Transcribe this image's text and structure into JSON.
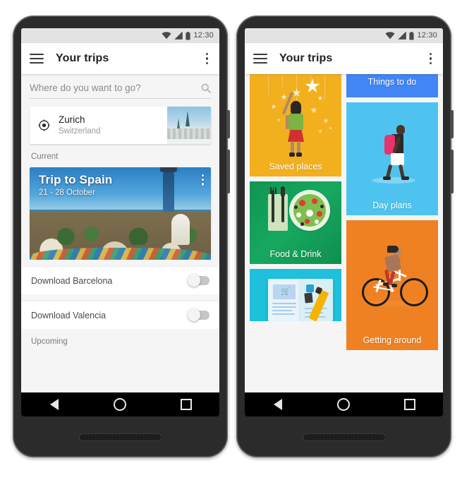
{
  "statusbar": {
    "time": "12:30",
    "wifi_icon": "wifi-icon",
    "signal_icon": "signal-icon",
    "battery_icon": "battery-icon"
  },
  "toolbar": {
    "menu_icon": "hamburger-menu-icon",
    "title": "Your trips",
    "overflow_icon": "overflow-menu-icon"
  },
  "left_screen": {
    "search": {
      "placeholder": "Where do you want to go?",
      "value": "",
      "icon": "search-icon"
    },
    "location_card": {
      "icon": "my-location-icon",
      "name": "Zurich",
      "country": "Switzerland",
      "thumb": "zurich-skyline-thumbnail"
    },
    "section_current": "Current",
    "trip": {
      "title": "Trip to Spain",
      "dates": "21 - 28 October",
      "hero": "park-guell-barcelona-photo",
      "overflow_icon": "trip-overflow-icon"
    },
    "downloads": [
      {
        "label": "Download Barcelona",
        "state": "off"
      },
      {
        "label": "Download Valencia",
        "state": "off"
      }
    ],
    "section_upcoming": "Upcoming"
  },
  "right_screen": {
    "tiles": [
      {
        "label": "Things to do",
        "color": "#4285f4",
        "illustration": "things-to-do-illustration",
        "column": "right",
        "cut": "top"
      },
      {
        "label": "Saved places",
        "color": "#f2b01e",
        "illustration": "girl-reaching-stars-illustration",
        "column": "left"
      },
      {
        "label": "Day plans",
        "color": "#4ec3f0",
        "illustration": "walking-traveler-backpack-illustration",
        "column": "right"
      },
      {
        "label": "Food & Drink",
        "color": "#12a05a",
        "illustration": "salad-plate-cutlery-illustration",
        "column": "left"
      },
      {
        "label": "Getting around",
        "color": "#ef8122",
        "illustration": "woman-riding-bicycle-illustration",
        "column": "right"
      },
      {
        "label": "",
        "color": "#1ec0db",
        "illustration": "guidebook-highlighter-illustration",
        "column": "left",
        "cut": "bottom"
      }
    ]
  },
  "navbar": {
    "back_icon": "back-triangle-icon",
    "home_icon": "home-circle-icon",
    "recents_icon": "recents-square-icon"
  },
  "hardware": {
    "camera": "front-camera",
    "earpiece": "earpiece-speaker-grille",
    "bottom_speaker": "bottom-speaker-grille",
    "power": "power-button",
    "volume": "volume-rocker"
  }
}
